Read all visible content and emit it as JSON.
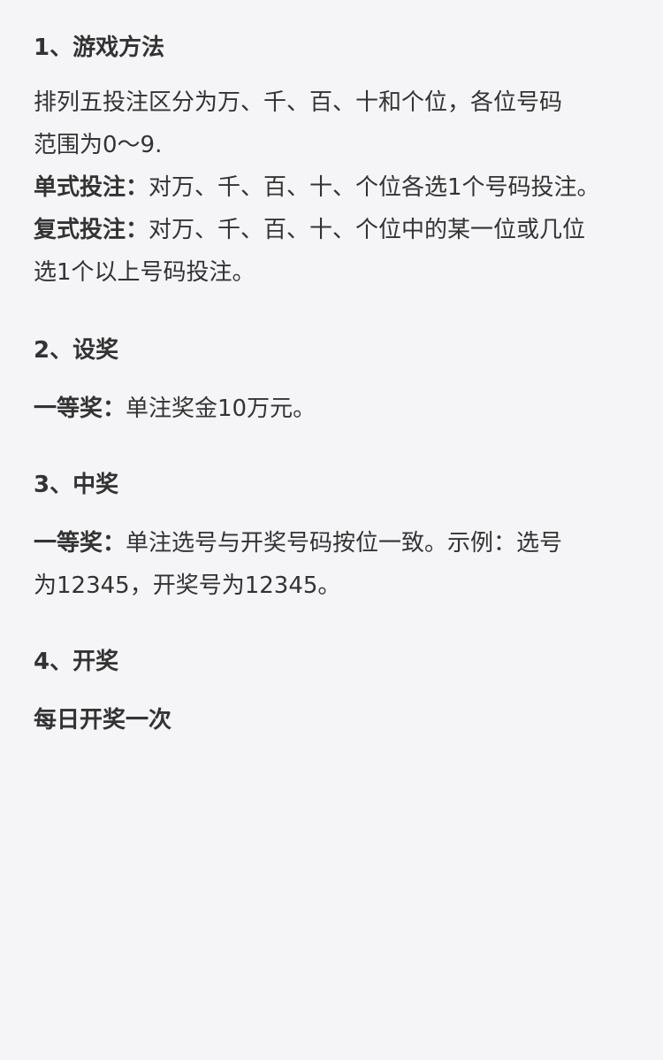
{
  "sections": [
    {
      "title": "1、游戏方法",
      "intro_lines": [
        "排列五投注区分为万、千、百、十和个位，各位号码",
        "范围为0～9."
      ],
      "single": {
        "label": "单式投注：",
        "text": "对万、千、百、十、个位各选1个号码投注。"
      },
      "multi": {
        "label": "复式投注：",
        "text_line1": "对万、千、百、十、个位中的某一位或几位",
        "text_line2": "选1个以上号码投注。"
      }
    },
    {
      "title": "2、设奖",
      "prize": {
        "label": "一等奖：",
        "text": "单注奖金10万元。"
      }
    },
    {
      "title": "3、中奖",
      "prize": {
        "label": "一等奖：",
        "text_line1": "单注选号与开奖号码按位一致。示例：选号",
        "text_line2": "为12345，开奖号为12345。"
      }
    },
    {
      "title": "4、开奖",
      "text": "每日开奖一次"
    }
  ]
}
